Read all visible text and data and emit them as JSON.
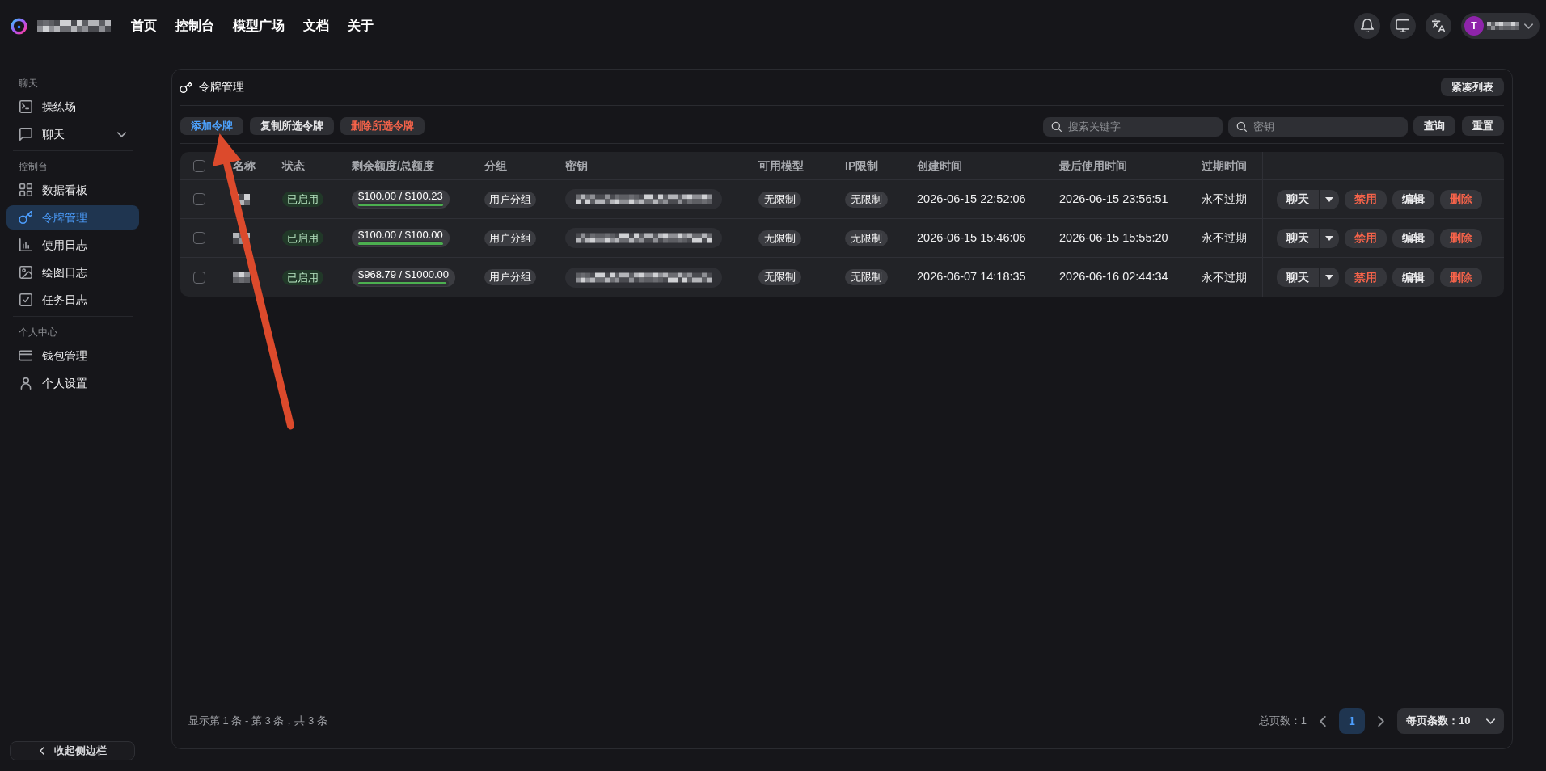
{
  "header": {
    "nav": [
      {
        "label": "首页"
      },
      {
        "label": "控制台"
      },
      {
        "label": "模型广场"
      },
      {
        "label": "文档"
      },
      {
        "label": "关于"
      }
    ],
    "user": {
      "avatar_letter": "T"
    }
  },
  "sidebar": {
    "sections": [
      {
        "heading": "聊天",
        "items": [
          {
            "label": "操练场",
            "selected": false
          },
          {
            "label": "聊天",
            "selected": false,
            "expanded": false
          }
        ]
      },
      {
        "heading": "控制台",
        "items": [
          {
            "label": "数据看板",
            "selected": false
          },
          {
            "label": "令牌管理",
            "selected": true
          },
          {
            "label": "使用日志",
            "selected": false
          },
          {
            "label": "绘图日志",
            "selected": false
          },
          {
            "label": "任务日志",
            "selected": false
          }
        ]
      },
      {
        "heading": "个人中心",
        "items": [
          {
            "label": "钱包管理",
            "selected": false
          },
          {
            "label": "个人设置",
            "selected": false
          }
        ]
      }
    ],
    "collapse_button": "收起侧边栏"
  },
  "panel": {
    "title": "令牌管理",
    "compact_button": "紧凑列表",
    "actions": [
      {
        "label": "添加令牌",
        "kind": "primary"
      },
      {
        "label": "复制所选令牌",
        "kind": "default"
      },
      {
        "label": "删除所选令牌",
        "kind": "danger"
      }
    ],
    "search_fields": [
      {
        "placeholder": "搜索关键字"
      },
      {
        "placeholder": "密钥"
      }
    ],
    "search_buttons": [
      "查询",
      "重置"
    ]
  },
  "table": {
    "select_all_checked": false,
    "columns": [
      "名称",
      "状态",
      "剩余额度/总额度",
      "分组",
      "密钥",
      "可用模型",
      "IP限制",
      "创建时间",
      "最后使用时间",
      "过期时间"
    ],
    "rows": [
      {
        "checked": false,
        "status": "已启用",
        "quota": "$100.00 / $100.23",
        "level": 0.998,
        "group": "用户分组",
        "models": "无限制",
        "ip_limit": "无限制",
        "created": "2026-06-15 22:52:06",
        "last_used": "2026-06-15 23:56:51",
        "expires": "永不过期",
        "actions": [
          {
            "label": "聊天",
            "kind": "split"
          },
          {
            "label": "禁用",
            "kind": "danger"
          },
          {
            "label": "编辑",
            "kind": "default"
          },
          {
            "label": "删除",
            "kind": "danger"
          }
        ]
      },
      {
        "checked": false,
        "status": "已启用",
        "quota": "$100.00 / $100.00",
        "level": 1,
        "group": "用户分组",
        "models": "无限制",
        "ip_limit": "无限制",
        "created": "2026-06-15 15:46:06",
        "last_used": "2026-06-15 15:55:20",
        "expires": "永不过期",
        "actions": [
          {
            "label": "聊天",
            "kind": "split"
          },
          {
            "label": "禁用",
            "kind": "danger"
          },
          {
            "label": "编辑",
            "kind": "default"
          },
          {
            "label": "删除",
            "kind": "danger"
          }
        ]
      },
      {
        "checked": false,
        "status": "已启用",
        "quota": "$968.79 / $1000.00",
        "level": 0.969,
        "group": "用户分组",
        "models": "无限制",
        "ip_limit": "无限制",
        "created": "2026-06-07 14:18:35",
        "last_used": "2026-06-16 02:44:34",
        "expires": "永不过期",
        "actions": [
          {
            "label": "聊天",
            "kind": "split"
          },
          {
            "label": "禁用",
            "kind": "danger"
          },
          {
            "label": "编辑",
            "kind": "default"
          },
          {
            "label": "删除",
            "kind": "danger"
          }
        ]
      }
    ]
  },
  "pagination": {
    "summary": "显示第 1 条 - 第 3 条，共 3 条",
    "total_pages": "总页数：1",
    "pages": [
      {
        "label": "1",
        "selected": true
      }
    ],
    "page_size": "每页条数：10"
  },
  "annotations": [
    {
      "kind": "arrow"
    }
  ]
}
